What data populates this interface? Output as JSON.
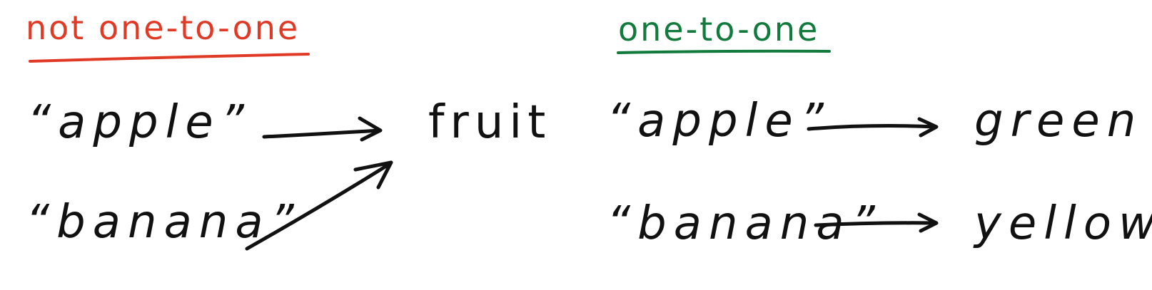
{
  "colors": {
    "not_one_to_one": "#e03a26",
    "one_to_one": "#127a3c",
    "ink": "#111111"
  },
  "left_panel": {
    "title": "not one-to-one",
    "inputs": [
      "“apple”",
      "“banana”"
    ],
    "output": "fruit"
  },
  "right_panel": {
    "title": "one-to-one",
    "pairs": [
      {
        "input": "“apple”",
        "output": "green"
      },
      {
        "input": "“banana”",
        "output": "yellow"
      }
    ]
  }
}
